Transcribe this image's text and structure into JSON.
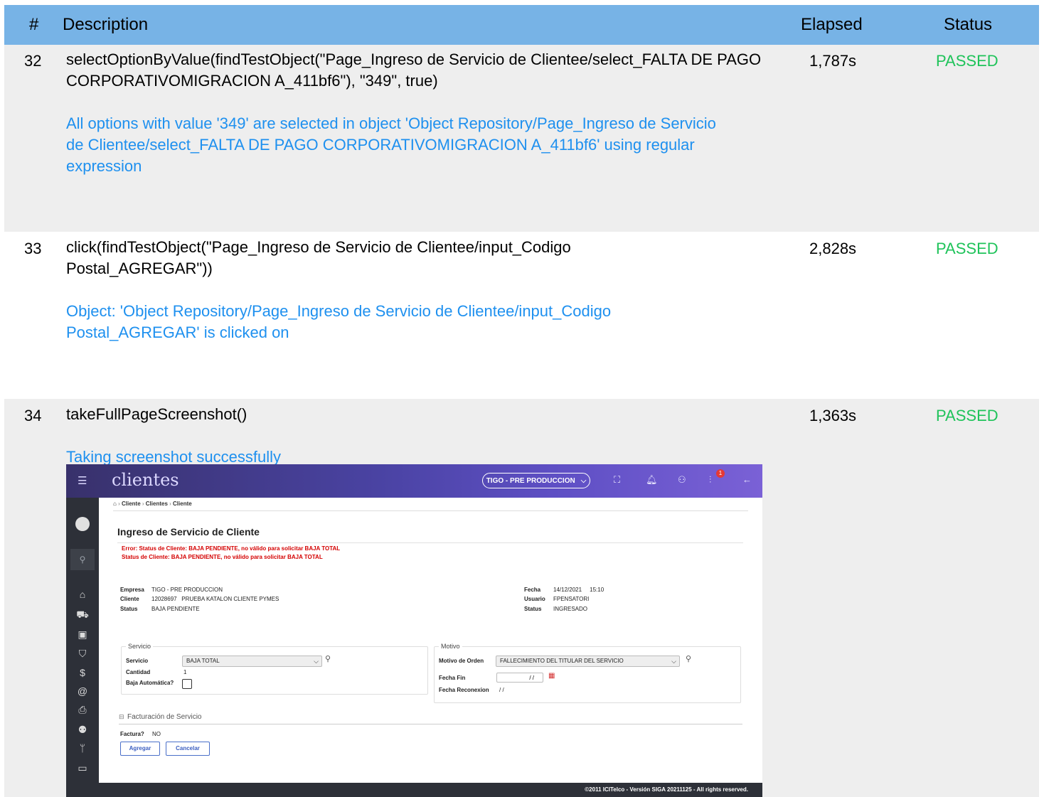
{
  "columns": {
    "num": "#",
    "description": "Description",
    "elapsed": "Elapsed",
    "status": "Status"
  },
  "steps": [
    {
      "num": "32",
      "command": "selectOptionByValue(findTestObject(\"Page_Ingreso de Servicio de Clientee/select_FALTA DE PAGO CORPORATIVOMIGRACION A_411bf6\"), \"349\", true)",
      "message": "All options with value '349' are selected in object 'Object Repository/Page_Ingreso de Servicio de Clientee/select_FALTA DE PAGO CORPORATIVOMIGRACION A_411bf6' using regular expression",
      "elapsed": "1,787s",
      "status": "PASSED"
    },
    {
      "num": "33",
      "command": "click(findTestObject(\"Page_Ingreso de Servicio de Clientee/input_Codigo Postal_AGREGAR\"))",
      "message": "Object: 'Object Repository/Page_Ingreso de Servicio de Clientee/input_Codigo Postal_AGREGAR' is clicked on",
      "elapsed": "2,828s",
      "status": "PASSED"
    },
    {
      "num": "34",
      "command": "takeFullPageScreenshot()",
      "message": "Taking screenshot successfully",
      "elapsed": "1,363s",
      "status": "PASSED"
    }
  ],
  "colors": {
    "header": "#77b3e6",
    "message": "#1e90ef",
    "passed": "#1fc35a",
    "error": "#d40000"
  },
  "screenshot": {
    "brand": "clientes",
    "environment": "TIGO - PRE PRODUCCION",
    "notification_count": "1",
    "breadcrumb": [
      "Cliente",
      "Clientes",
      "Cliente"
    ],
    "title": "Ingreso de Servicio de Cliente",
    "errors": [
      "Error: Status de Cliente: BAJA PENDIENTE, no válido para solicitar BAJA TOTAL",
      "Status de Cliente: BAJA PENDIENTE, no válido para solicitar BAJA TOTAL"
    ],
    "info_left": {
      "empresa_label": "Empresa",
      "empresa": "TIGO - PRE PRODUCCION",
      "cliente_label": "Cliente",
      "cliente": "12028697   PRUEBA KATALON CLIENTE PYMES",
      "status_label": "Status",
      "status": "BAJA PENDIENTE"
    },
    "info_right": {
      "fecha_label": "Fecha",
      "fecha": "14/12/2021     15:10",
      "usuario_label": "Usuario",
      "usuario": "FPENSATORI",
      "status_label": "Status",
      "status": "INGRESADO"
    },
    "servicio": {
      "legend": "Servicio",
      "servicio_label": "Servicio",
      "servicio_value": "BAJA TOTAL",
      "cantidad_label": "Cantidad",
      "cantidad": "1",
      "baja_label": "Baja Automática?"
    },
    "motivo": {
      "legend": "Motivo",
      "orden_label": "Motivo de Orden",
      "orden_value": "FALLECIMIENTO DEL TITULAR DEL SERVICIO",
      "fecha_fin_label": "Fecha Fin",
      "fecha_fin": "/ /",
      "reconexion_label": "Fecha Reconexion",
      "reconexion": "/ /"
    },
    "facturacion": {
      "title": "Facturación de Servicio",
      "factura_label": "Factura?",
      "factura": "NO"
    },
    "buttons": {
      "agregar": "Agregar",
      "cancelar": "Cancelar"
    },
    "footer": "©2011 ICITelco - Versión SIGA 20211125 - All rights reserved."
  }
}
